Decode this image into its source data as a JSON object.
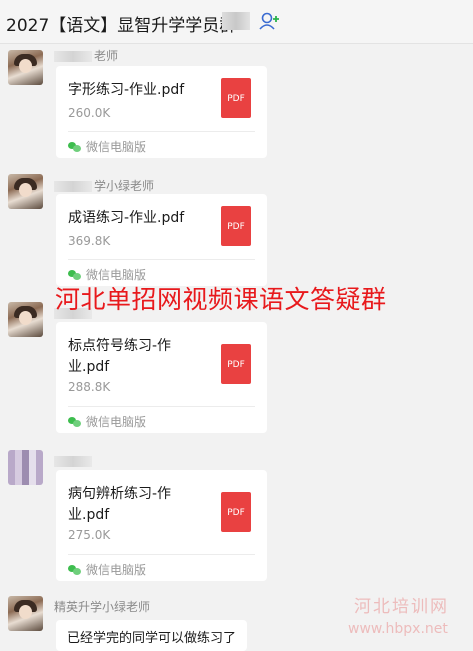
{
  "window": {
    "title": "2027【语文】显智升学学员群"
  },
  "overlay_text": "河北单招网视频课语文答疑群",
  "messages": [
    {
      "sender": "老师",
      "file_name": "字形练习-作业.pdf",
      "file_size": "260.0K",
      "source": "微信电脑版",
      "file_type": "PDF"
    },
    {
      "sender": "学小绿老师",
      "file_name": "成语练习-作业.pdf",
      "file_size": "369.8K",
      "source": "微信电脑版",
      "file_type": "PDF"
    },
    {
      "sender": "",
      "file_name": "标点符号练习-作业.pdf",
      "file_size": "288.8K",
      "source": "微信电脑版",
      "file_type": "PDF"
    },
    {
      "sender": "",
      "file_name": "病句辨析练习-作业.pdf",
      "file_size": "275.0K",
      "source": "微信电脑版",
      "file_type": "PDF"
    }
  ],
  "last_message": {
    "sender": "精英升学小绿老师",
    "text": "已经学完的同学可以做练习了"
  },
  "watermark": {
    "line1": "河北培训网",
    "line2": "www.hbpx.net"
  },
  "colors": {
    "pdf": "#e94141",
    "wechat_green": "#3dbd4e",
    "overlay_red": "#e8191c"
  },
  "icons": {
    "title_action": "add-member-icon",
    "source": "wechat-icon",
    "file": "pdf-file-icon"
  }
}
